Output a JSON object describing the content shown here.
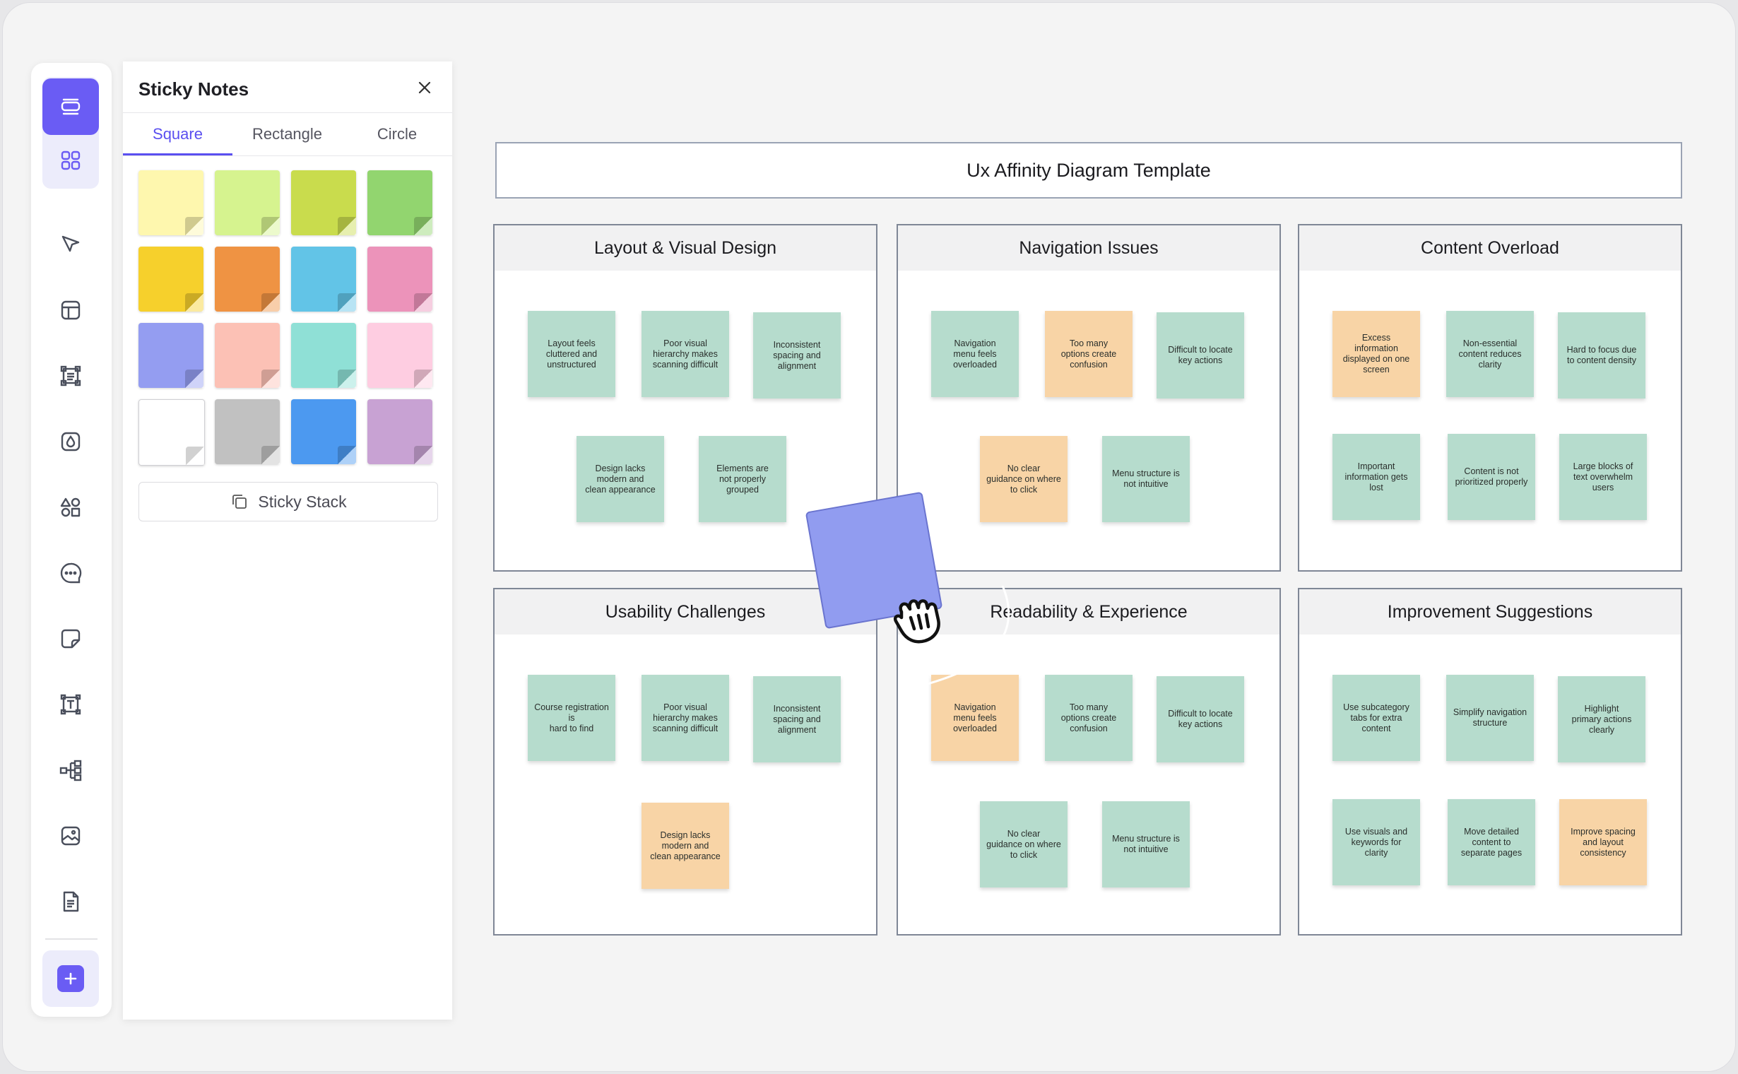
{
  "panel": {
    "title": "Sticky Notes",
    "tabs": [
      "Square",
      "Rectangle",
      "Circle"
    ],
    "active_tab": "Square",
    "swatch_colors": [
      "#fef7ae",
      "#d6f38f",
      "#c9dc4d",
      "#92d56f",
      "#f6d02c",
      "#ef9343",
      "#62c4e7",
      "#ec93ba",
      "#949df1",
      "#fcc1b5",
      "#8fe0d6",
      "#fecde1",
      "#ffffff",
      "#c1c1c1",
      "#4c99f0",
      "#c8a2d3"
    ],
    "stack_button_label": "Sticky Stack"
  },
  "toolbar": {
    "icons": [
      "template-icon",
      "grid-icon",
      "cursor-icon",
      "layout-icon",
      "frame-icon",
      "droplet-icon",
      "shapes-icon",
      "comment-icon",
      "sticky-note-icon",
      "text-icon",
      "mindmap-icon",
      "image-icon",
      "document-icon",
      "plus-icon"
    ],
    "accent": "#6a5cf4"
  },
  "board": {
    "title": "Ux Affinity Diagram Template",
    "colors": {
      "green": "#b6dccd",
      "orange": "#f8d4a6"
    },
    "groups": [
      {
        "title": "Layout & Visual Design",
        "notes": [
          {
            "text": "Layout feels\ncluttered and\nunstructured",
            "color": "green"
          },
          {
            "text": "Poor visual\nhierarchy makes\nscanning difficult",
            "color": "green"
          },
          {
            "text": "Inconsistent\nspacing and\nalignment",
            "color": "green"
          },
          {
            "text": "Design lacks\nmodern and\nclean appearance",
            "color": "green"
          },
          {
            "text": "Elements are\nnot properly\ngrouped",
            "color": "green"
          }
        ]
      },
      {
        "title": "Navigation Issues",
        "notes": [
          {
            "text": "Navigation\nmenu feels\noverloaded",
            "color": "green"
          },
          {
            "text": "Too many\noptions create\nconfusion",
            "color": "orange"
          },
          {
            "text": "Difficult to locate\nkey actions",
            "color": "green"
          },
          {
            "text": "No clear\nguidance on where\nto click",
            "color": "orange"
          },
          {
            "text": "Menu structure is\nnot intuitive",
            "color": "green"
          }
        ]
      },
      {
        "title": "Content Overload",
        "notes": [
          {
            "text": "Excess\ninformation\ndisplayed on one\nscreen",
            "color": "orange"
          },
          {
            "text": "Non-essential\ncontent reduces\nclarity",
            "color": "green"
          },
          {
            "text": "Hard to focus due\nto content density",
            "color": "green"
          },
          {
            "text": "Important\ninformation gets\nlost",
            "color": "green"
          },
          {
            "text": "Content is not\nprioritized properly",
            "color": "green"
          },
          {
            "text": "Large blocks of\ntext overwhelm\nusers",
            "color": "green"
          }
        ]
      },
      {
        "title": "Usability Challenges",
        "notes": [
          {
            "text": "Course registration\nis\nhard to find",
            "color": "green"
          },
          {
            "text": "Poor visual\nhierarchy makes\nscanning difficult",
            "color": "green"
          },
          {
            "text": "Inconsistent\nspacing and\nalignment",
            "color": "green"
          },
          {
            "text": "Design lacks\nmodern and\nclean appearance",
            "color": "orange"
          }
        ]
      },
      {
        "title": "Readability & Experience",
        "notes": [
          {
            "text": "Navigation\nmenu feels\noverloaded",
            "color": "orange"
          },
          {
            "text": "Too many\noptions create\nconfusion",
            "color": "green"
          },
          {
            "text": "Difficult to locate\nkey actions",
            "color": "green"
          },
          {
            "text": "No clear\nguidance on where\nto click",
            "color": "green"
          },
          {
            "text": "Menu structure is\nnot intuitive",
            "color": "green"
          }
        ]
      },
      {
        "title": "Improvement Suggestions",
        "notes": [
          {
            "text": "Use subcategory\ntabs for extra\ncontent",
            "color": "green"
          },
          {
            "text": "Simplify navigation\nstructure",
            "color": "green"
          },
          {
            "text": "Highlight\nprimary actions\nclearly",
            "color": "green"
          },
          {
            "text": "Use visuals and\nkeywords for\nclarity",
            "color": "green"
          },
          {
            "text": "Move detailed\ncontent to\nseparate pages",
            "color": "green"
          },
          {
            "text": "Improve spacing\nand layout\nconsistency",
            "color": "orange"
          }
        ]
      }
    ]
  },
  "dragged_note_color": "#919cf0"
}
